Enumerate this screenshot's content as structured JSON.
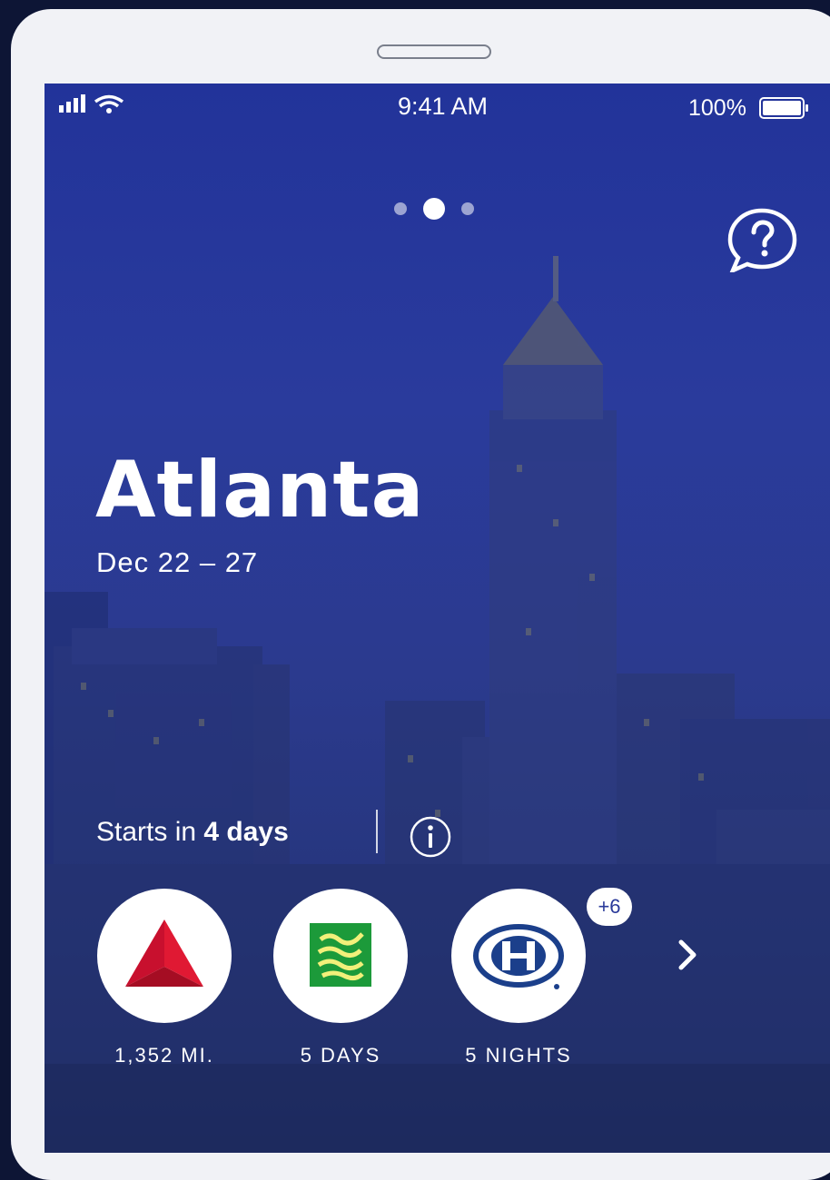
{
  "status_bar": {
    "time": "9:41 AM",
    "battery_percent": "100%",
    "battery_level": 1.0,
    "icons": [
      "signal-icon",
      "wifi-icon",
      "battery-icon"
    ]
  },
  "pager": {
    "pages": 3,
    "active_index": 1
  },
  "help_icon": "question-chat-icon",
  "trip": {
    "city": "Atlanta",
    "dates": "Dec 22 – 27",
    "starts_prefix": "Starts in",
    "starts_value": "4 days"
  },
  "info_icon": "info-icon",
  "summary": [
    {
      "icon": "delta-logo-icon",
      "label": "1,352 MI."
    },
    {
      "icon": "car-rental-logo-icon",
      "label": "5 DAYS"
    },
    {
      "icon": "hilton-logo-icon",
      "label": "5 NIGHTS"
    }
  ],
  "more_badge": "+6",
  "colors": {
    "background_blue": "#2a3a9a",
    "delta_red": "#e01933",
    "rental_green": "#1c9a3a",
    "hilton_blue": "#1b3f8b"
  }
}
